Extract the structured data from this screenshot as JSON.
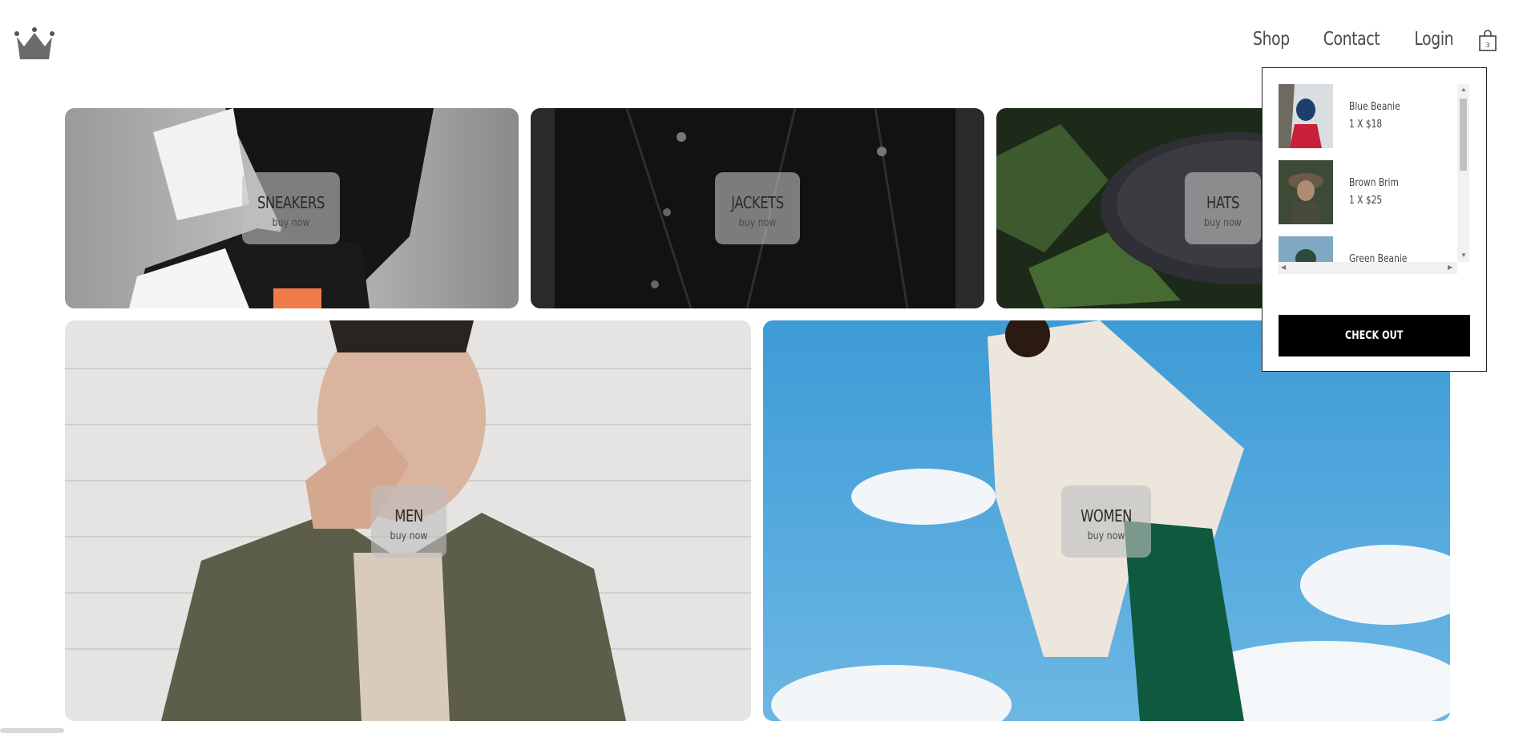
{
  "nav": {
    "items": [
      "Shop",
      "Contact",
      "Login"
    ],
    "cart_count": "3"
  },
  "tiles": [
    {
      "title": "SNEAKERS",
      "action": "buy now"
    },
    {
      "title": "JACKETS",
      "action": "buy now"
    },
    {
      "title": "HATS",
      "action": "buy now"
    },
    {
      "title": "MEN",
      "action": "buy now"
    },
    {
      "title": "WOMEN",
      "action": "buy now"
    }
  ],
  "cart": {
    "items": [
      {
        "name": "Blue Beanie",
        "qty": "1 X $18"
      },
      {
        "name": "Brown Brim",
        "qty": "1 X $25"
      },
      {
        "name": "Green Beanie",
        "qty": ""
      }
    ],
    "checkout_label": "CHECK OUT"
  },
  "colors": {
    "checkout_bg": "#000000",
    "label_box": "#bebebe",
    "sky": "#4aa3d8",
    "text": "#4a4a4a"
  },
  "icons": [
    "crown-icon",
    "shopping-bag-icon"
  ]
}
